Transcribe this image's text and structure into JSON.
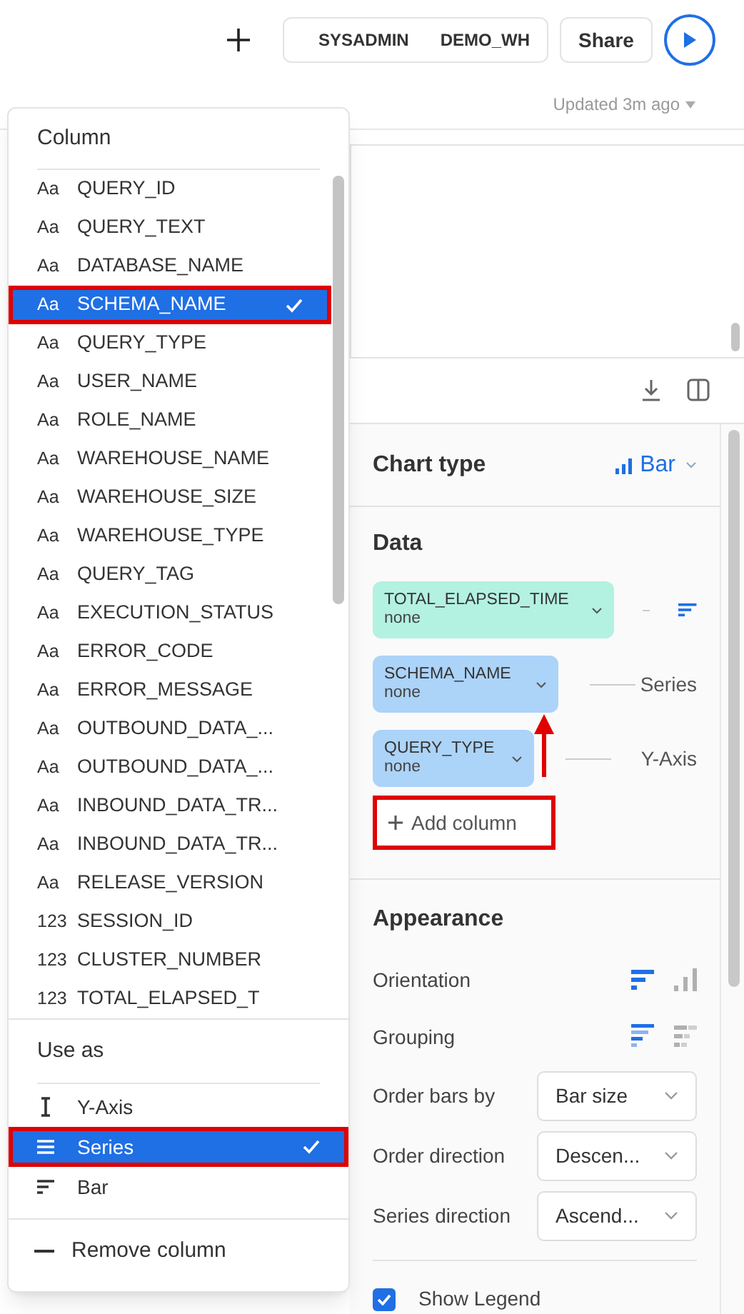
{
  "header": {
    "user": "SYSADMIN",
    "warehouse": "DEMO_WH",
    "share_button": "Share",
    "updated": "Updated 3m ago"
  },
  "column_menu": {
    "title": "Column",
    "items": [
      {
        "type": "Aa",
        "name": "QUERY_ID",
        "selected": false
      },
      {
        "type": "Aa",
        "name": "QUERY_TEXT",
        "selected": false
      },
      {
        "type": "Aa",
        "name": "DATABASE_NAME",
        "selected": false
      },
      {
        "type": "Aa",
        "name": "SCHEMA_NAME",
        "selected": true
      },
      {
        "type": "Aa",
        "name": "QUERY_TYPE",
        "selected": false
      },
      {
        "type": "Aa",
        "name": "USER_NAME",
        "selected": false
      },
      {
        "type": "Aa",
        "name": "ROLE_NAME",
        "selected": false
      },
      {
        "type": "Aa",
        "name": "WAREHOUSE_NAME",
        "selected": false
      },
      {
        "type": "Aa",
        "name": "WAREHOUSE_SIZE",
        "selected": false
      },
      {
        "type": "Aa",
        "name": "WAREHOUSE_TYPE",
        "selected": false
      },
      {
        "type": "Aa",
        "name": "QUERY_TAG",
        "selected": false
      },
      {
        "type": "Aa",
        "name": "EXECUTION_STATUS",
        "selected": false
      },
      {
        "type": "Aa",
        "name": "ERROR_CODE",
        "selected": false
      },
      {
        "type": "Aa",
        "name": "ERROR_MESSAGE",
        "selected": false
      },
      {
        "type": "Aa",
        "name": "OUTBOUND_DATA_...",
        "selected": false
      },
      {
        "type": "Aa",
        "name": "OUTBOUND_DATA_...",
        "selected": false
      },
      {
        "type": "Aa",
        "name": "INBOUND_DATA_TR...",
        "selected": false
      },
      {
        "type": "Aa",
        "name": "INBOUND_DATA_TR...",
        "selected": false
      },
      {
        "type": "Aa",
        "name": "RELEASE_VERSION",
        "selected": false
      },
      {
        "type": "123",
        "name": "SESSION_ID",
        "selected": false
      },
      {
        "type": "123",
        "name": "CLUSTER_NUMBER",
        "selected": false
      },
      {
        "type": "123",
        "name": "TOTAL_ELAPSED_T",
        "selected": false
      }
    ]
  },
  "use_as_menu": {
    "title": "Use as",
    "options": [
      {
        "kind": "axis",
        "label": "Y-Axis",
        "selected": false
      },
      {
        "kind": "series",
        "label": "Series",
        "selected": true
      },
      {
        "kind": "bar",
        "label": "Bar",
        "selected": false
      }
    ],
    "remove": "Remove column"
  },
  "chart_settings": {
    "chart_type": {
      "label": "Chart type",
      "value": "Bar"
    },
    "data": {
      "title": "Data",
      "columns": [
        {
          "name": "TOTAL_ELAPSED_TIME",
          "aggregation": "none",
          "color": "#b3f1e0",
          "kind": "bar"
        },
        {
          "name": "SCHEMA_NAME",
          "aggregation": "none",
          "color": "#acd3f8",
          "kind": "label",
          "role": "Series"
        },
        {
          "name": "QUERY_TYPE",
          "aggregation": "none",
          "color": "#acd3f8",
          "kind": "label",
          "role": "Y-Axis"
        }
      ],
      "add_column": {
        "label": "Add column",
        "annotated": true
      }
    },
    "appearance": {
      "title": "Appearance",
      "orientation": {
        "label": "Orientation",
        "options": [
          {
            "kind": "horizontal",
            "selected": true
          },
          {
            "kind": "vertical",
            "selected": false
          }
        ]
      },
      "grouping": {
        "label": "Grouping",
        "options": [
          {
            "kind": "grouped",
            "selected": true
          },
          {
            "kind": "stacked",
            "selected": false
          }
        ]
      },
      "fields": [
        {
          "label": "Order bars by",
          "value": "Bar size"
        },
        {
          "label": "Order direction",
          "value": "Descen..."
        },
        {
          "label": "Series direction",
          "value": "Ascend..."
        }
      ],
      "show_legend": {
        "label": "Show Legend",
        "checked": true
      }
    }
  }
}
